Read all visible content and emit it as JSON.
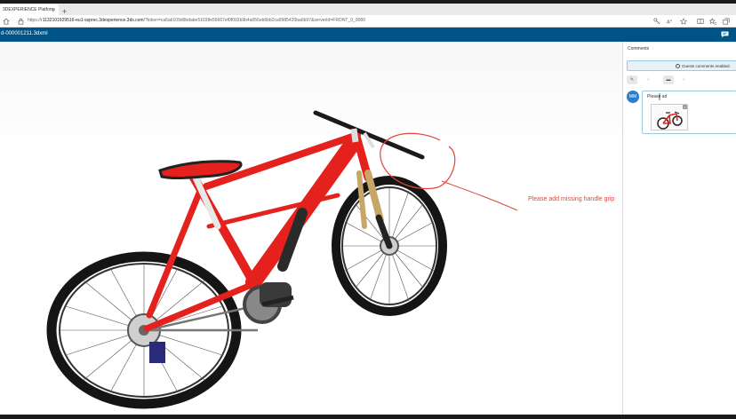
{
  "browser": {
    "tab_title": "3DEXPERIENCE Platform",
    "tab_close": "×",
    "new_tab": "+",
    "url_prefix": "https://r",
    "url_host": "1132101929516-eu1-ssprec.3dexperience.3ds.com",
    "url_rest": "/?token=ca6ab109d9bdabe51038e56667ef0f092b9b4a056eb6bb2ca9985420ba6b97&serverId=FRONT_0_9089"
  },
  "app": {
    "document_title": "d-000001211.3dxml",
    "accent_color": "#005386"
  },
  "viewport": {
    "annotation_text": "Please add missing handle grip",
    "annotation_color": "#e0453a"
  },
  "comments_panel": {
    "title": "Comments",
    "guest_notice": "Guests comments enabled.",
    "tools": [
      {
        "icon": "pencil-icon",
        "glyph": "✎",
        "active": true
      },
      {
        "icon": "sketch-icon",
        "glyph": "⁝",
        "active": false
      },
      {
        "icon": "comment-icon",
        "glyph": "▬",
        "active": true
      },
      {
        "icon": "more-icon",
        "glyph": "⁝",
        "active": false
      }
    ],
    "comment": {
      "author_initials": "MM",
      "text": "Please ad"
    }
  }
}
